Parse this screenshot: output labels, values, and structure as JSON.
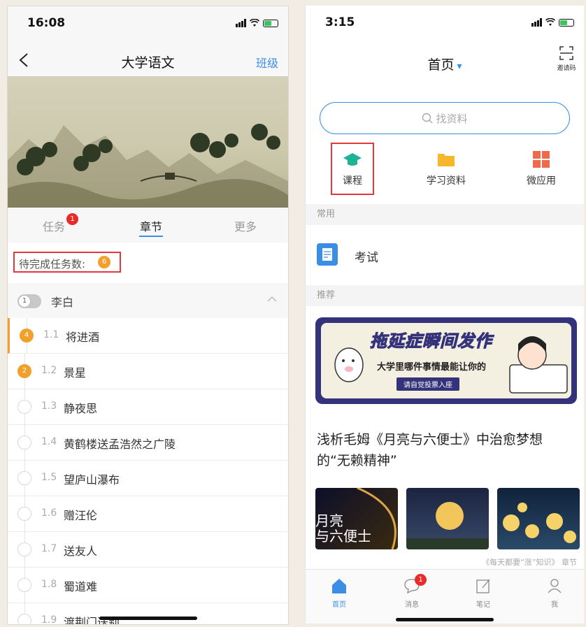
{
  "left_phone": {
    "status": {
      "time": "16:08"
    },
    "nav": {
      "title": "大学语文",
      "right_label": "班级"
    },
    "tabs": {
      "tasks_label": "任务",
      "tasks_badge": "1",
      "chapters_label": "章节",
      "more_label": "更多"
    },
    "pending": {
      "label": "待完成任务数:",
      "count": "6"
    },
    "chapter": {
      "number": "1",
      "name": "李白"
    },
    "lessons": [
      {
        "num": "1.1",
        "title": "将进酒",
        "badge": "4"
      },
      {
        "num": "1.2",
        "title": "景星",
        "badge": "2"
      },
      {
        "num": "1.3",
        "title": "静夜思",
        "badge": ""
      },
      {
        "num": "1.4",
        "title": "黄鹤楼送孟浩然之广陵",
        "badge": ""
      },
      {
        "num": "1.5",
        "title": "望庐山瀑布",
        "badge": ""
      },
      {
        "num": "1.6",
        "title": "赠汪伦",
        "badge": ""
      },
      {
        "num": "1.7",
        "title": "送友人",
        "badge": ""
      },
      {
        "num": "1.8",
        "title": "蜀道难",
        "badge": ""
      },
      {
        "num": "1.9",
        "title": "渡荆门送别",
        "badge": ""
      }
    ]
  },
  "right_phone": {
    "status": {
      "time": "3:15"
    },
    "nav": {
      "title": "首页",
      "invite_label": "邀请码"
    },
    "search": {
      "placeholder": "找资料"
    },
    "quick": [
      {
        "label": "课程",
        "icon": "graduation-cap-icon"
      },
      {
        "label": "学习资料",
        "icon": "folder-icon"
      },
      {
        "label": "微应用",
        "icon": "apps-grid-icon"
      }
    ],
    "sections": {
      "common": "常用",
      "recommend": "推荐"
    },
    "exam": {
      "label": "考试"
    },
    "promo": {
      "title": "拖延症瞬间发作",
      "subtitle": "大学里哪件事情最能让你的",
      "tag": "请自觉投票入座"
    },
    "article": {
      "title": "浅析毛姆《月亮与六便士》中治愈梦想的“无赖精神”",
      "thumb_text": "月亮\n与六便士",
      "caption": "《每天都要“涨”知识》 章节"
    },
    "tabbar": [
      {
        "label": "首页",
        "icon": "home-icon"
      },
      {
        "label": "消息",
        "icon": "message-icon",
        "badge": "1"
      },
      {
        "label": "笔记",
        "icon": "note-icon"
      },
      {
        "label": "我",
        "icon": "person-icon"
      }
    ]
  },
  "colors": {
    "accent": "#3a8ee6",
    "badge_red": "#e92b2b",
    "badge_orange": "#f2a02c",
    "highlight_red": "#e3383d",
    "promo_navy": "#34327a"
  }
}
